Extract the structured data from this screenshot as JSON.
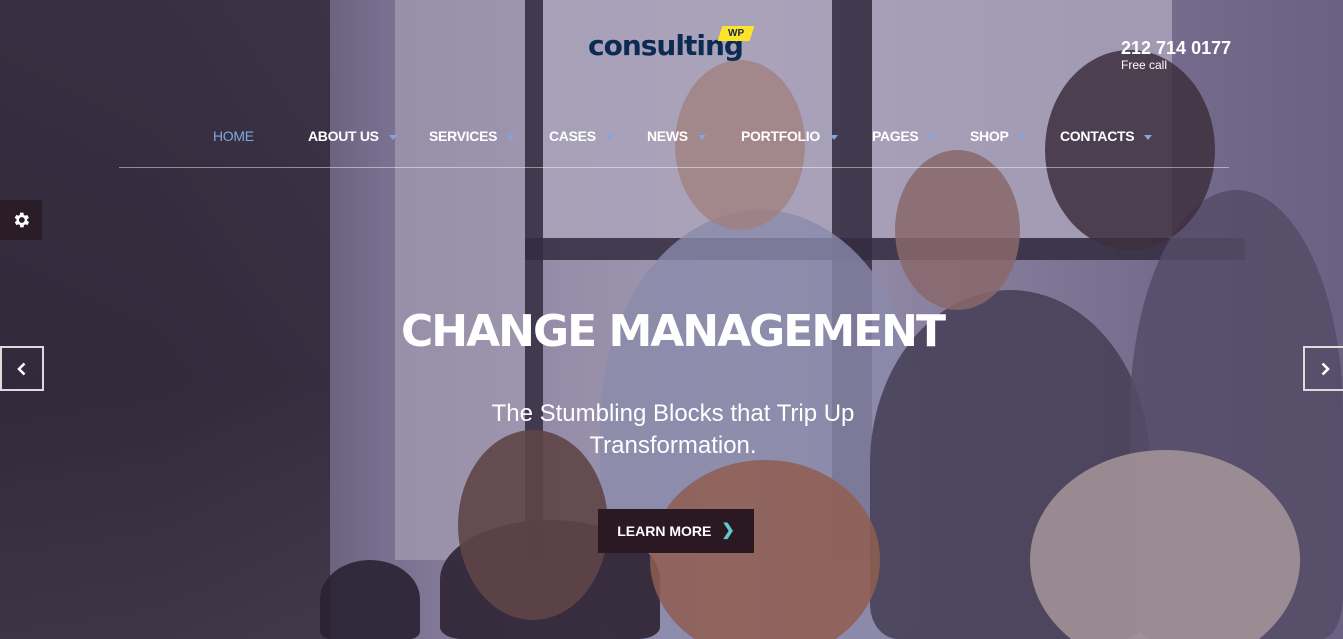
{
  "brand": {
    "name": "consulting",
    "badge": "WP",
    "logo_color": "#0d2a52",
    "badge_color": "#fde428"
  },
  "contact": {
    "phone": "212 714 0177",
    "label": "Free call"
  },
  "nav": {
    "accent_color": "#7ea6e0",
    "items": [
      {
        "label": "HOME",
        "active": true,
        "has_dropdown": false
      },
      {
        "label": "ABOUT US",
        "active": false,
        "has_dropdown": true
      },
      {
        "label": "SERVICES",
        "active": false,
        "has_dropdown": true
      },
      {
        "label": "CASES",
        "active": false,
        "has_dropdown": true
      },
      {
        "label": "NEWS",
        "active": false,
        "has_dropdown": true
      },
      {
        "label": "PORTFOLIO",
        "active": false,
        "has_dropdown": true
      },
      {
        "label": "PAGES",
        "active": false,
        "has_dropdown": true
      },
      {
        "label": "SHOP",
        "active": false,
        "has_dropdown": true
      },
      {
        "label": "CONTACTS",
        "active": false,
        "has_dropdown": true
      }
    ]
  },
  "slide": {
    "title": "CHANGE MANAGEMENT",
    "subtitle": "The Stumbling Blocks that Trip Up Transformation.",
    "cta_label": "LEARN MORE",
    "cta_color": "#2a1923"
  },
  "controls": {
    "settings_icon": "gear-icon",
    "prev_icon": "chevron-left-icon",
    "next_icon": "chevron-right-icon"
  }
}
